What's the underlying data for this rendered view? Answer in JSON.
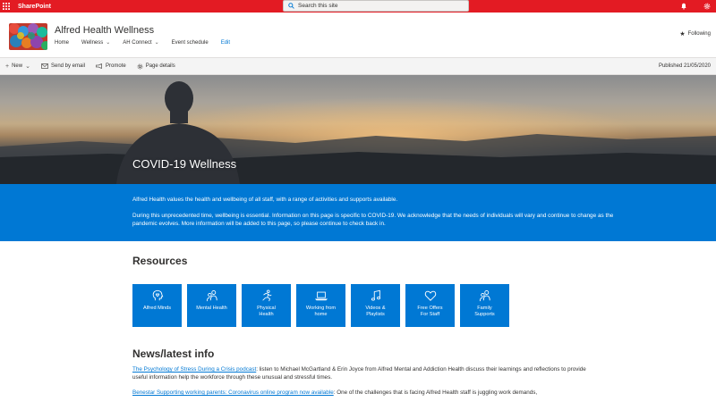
{
  "suite": {
    "brand": "SharePoint",
    "search_placeholder": "Search this site"
  },
  "site": {
    "title": "Alfred Health Wellness",
    "nav": [
      {
        "label": "Home",
        "dropdown": false
      },
      {
        "label": "Wellness",
        "dropdown": true
      },
      {
        "label": "AH Connect",
        "dropdown": true
      },
      {
        "label": "Event schedule",
        "dropdown": false
      },
      {
        "label": "Edit",
        "dropdown": false
      }
    ],
    "following": "Following"
  },
  "command_bar": {
    "new": "New",
    "send_by_email": "Send by email",
    "promote": "Promote",
    "page_details": "Page details",
    "published": "Published 21/05/2020"
  },
  "hero": {
    "title": "COVID-19 Wellness"
  },
  "banner": {
    "p1": "Alfred Health values the health and wellbeing of all staff, with a range of activities and supports available.",
    "p2": "During this unprecedented time, wellbeing is essential. Information on this page is specific to COVID-19. We acknowledge that the needs of individuals will vary and continue to change as the pandemic evolves. More information will be added to this page, so please continue to check back in."
  },
  "resources": {
    "heading": "Resources",
    "tiles": [
      {
        "label": "Alfred Minds",
        "icon": "head-heart-icon"
      },
      {
        "label": "Mental Health",
        "icon": "people-icon"
      },
      {
        "label": "Physical\nHealth",
        "icon": "running-icon"
      },
      {
        "label": "Working from\nhome",
        "icon": "laptop-icon"
      },
      {
        "label": "Videos &\nPlaylists",
        "icon": "music-note-icon"
      },
      {
        "label": "Free Offers\nFor Staff",
        "icon": "heart-icon"
      },
      {
        "label": "Family\nSupports",
        "icon": "people-icon"
      }
    ]
  },
  "news": {
    "heading": "News/latest info",
    "items": [
      {
        "link": "The Psychology of Stress During a Crisis podcast",
        "text": ": listen to Michael McGartland & Erin Joyce from Alfred Mental and Addiction Health discuss their learnings and reflections to provide useful information help the workforce through these unusual and stressful times."
      },
      {
        "link": "Benestar Supporting working parents: Coronavirus online program now available",
        "text": ": One of the challenges that is facing Alfred Health staff is juggling work demands,"
      }
    ]
  },
  "colors": {
    "suite_bar": "#e31b23",
    "accent_blue": "#0078d4",
    "command_bar": "#f4f4f4"
  }
}
